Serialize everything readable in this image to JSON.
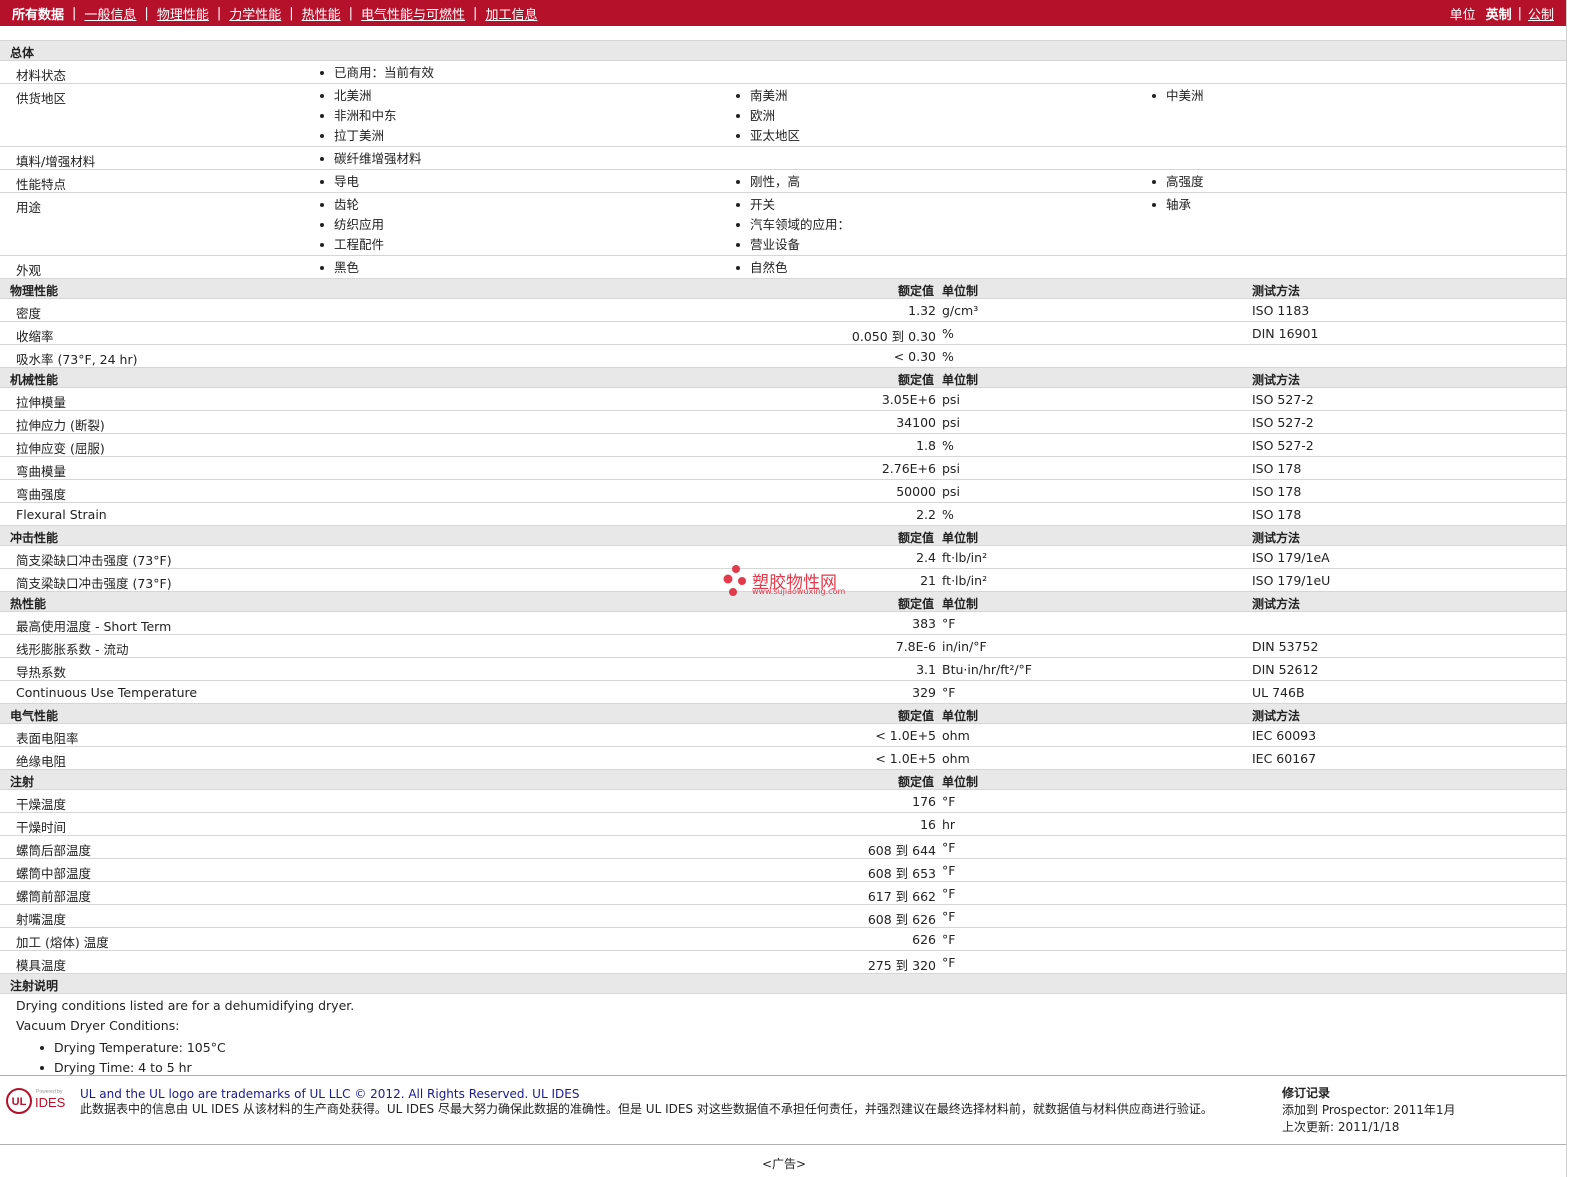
{
  "nav": {
    "items": [
      "所有数据",
      "一般信息",
      "物理性能",
      "力学性能",
      "热性能",
      "电气性能与可燃性",
      "加工信息"
    ]
  },
  "units": {
    "label": "单位",
    "imperial": "英制",
    "metric": "公制"
  },
  "headers": {
    "value": "额定值",
    "unit": "单位制",
    "test": "测试方法"
  },
  "general": {
    "title": "总体",
    "rows": [
      {
        "label": "材料状态",
        "cols": [
          [
            "已商用：当前有效"
          ],
          [],
          []
        ]
      },
      {
        "label": "供货地区",
        "cols": [
          [
            "北美洲",
            "非洲和中东",
            "拉丁美洲"
          ],
          [
            "南美洲",
            "欧洲",
            "亚太地区"
          ],
          [
            "中美洲"
          ]
        ]
      },
      {
        "label": "填料/增强材料",
        "cols": [
          [
            "碳纤维增强材料"
          ],
          [],
          []
        ]
      },
      {
        "label": "性能特点",
        "cols": [
          [
            "导电"
          ],
          [
            "刚性，高"
          ],
          [
            "高强度"
          ]
        ]
      },
      {
        "label": "用途",
        "cols": [
          [
            "齿轮",
            "纺织应用",
            "工程配件"
          ],
          [
            "开关",
            "汽车领域的应用：",
            "营业设备"
          ],
          [
            "轴承"
          ]
        ]
      },
      {
        "label": "外观",
        "cols": [
          [
            "黑色"
          ],
          [
            "自然色"
          ],
          []
        ]
      }
    ]
  },
  "sections": [
    {
      "title": "物理性能",
      "test_header": true,
      "rows": [
        {
          "label": "密度",
          "value": "1.32",
          "unit": "g/cm³",
          "test": "ISO 1183"
        },
        {
          "label": "收缩率",
          "value": "0.050 到  0.30",
          "unit": "%",
          "test": "DIN 16901"
        },
        {
          "label": "吸水率 (73°F, 24 hr)",
          "value": "< 0.30",
          "unit": "%",
          "test": ""
        }
      ]
    },
    {
      "title": "机械性能",
      "test_header": true,
      "rows": [
        {
          "label": "拉伸模量",
          "value": "3.05E+6",
          "unit": "psi",
          "test": "ISO 527-2"
        },
        {
          "label": "拉伸应力 (断裂)",
          "value": "34100",
          "unit": "psi",
          "test": "ISO 527-2"
        },
        {
          "label": "拉伸应变 (屈服)",
          "value": "1.8",
          "unit": "%",
          "test": "ISO 527-2"
        },
        {
          "label": "弯曲模量",
          "value": "2.76E+6",
          "unit": "psi",
          "test": "ISO 178"
        },
        {
          "label": "弯曲强度",
          "value": "50000",
          "unit": "psi",
          "test": "ISO 178"
        },
        {
          "label": "Flexural Strain",
          "value": "2.2",
          "unit": "%",
          "test": "ISO 178"
        }
      ]
    },
    {
      "title": "冲击性能",
      "test_header": true,
      "rows": [
        {
          "label": "简支梁缺口冲击强度 (73°F)",
          "value": "2.4",
          "unit": "ft·lb/in²",
          "test": "ISO 179/1eA"
        },
        {
          "label": "简支梁缺口冲击强度 (73°F)",
          "value": "21",
          "unit": "ft·lb/in²",
          "test": "ISO 179/1eU"
        }
      ]
    },
    {
      "title": "热性能",
      "test_header": true,
      "rows": [
        {
          "label": "最高使用温度 - Short Term",
          "value": "383",
          "unit": "°F",
          "test": ""
        },
        {
          "label": "线形膨胀系数 - 流动",
          "value": "7.8E-6",
          "unit": "in/in/°F",
          "test": "DIN 53752"
        },
        {
          "label": "导热系数",
          "value": "3.1",
          "unit": "Btu·in/hr/ft²/°F",
          "test": "DIN 52612"
        },
        {
          "label": "Continuous Use Temperature",
          "value": "329",
          "unit": "°F",
          "test": "UL 746B"
        }
      ]
    },
    {
      "title": "电气性能",
      "test_header": true,
      "rows": [
        {
          "label": "表面电阻率",
          "value": "< 1.0E+5",
          "unit": "ohm",
          "test": "IEC 60093"
        },
        {
          "label": "绝缘电阻",
          "value": "< 1.0E+5",
          "unit": "ohm",
          "test": "IEC 60167"
        }
      ]
    },
    {
      "title": "注射",
      "test_header": false,
      "rows": [
        {
          "label": "干燥温度",
          "value": "176",
          "unit": "°F",
          "test": ""
        },
        {
          "label": "干燥时间",
          "value": "16",
          "unit": "hr",
          "test": ""
        },
        {
          "label": "螺筒后部温度",
          "value": "608 到  644",
          "unit": "°F",
          "test": ""
        },
        {
          "label": "螺筒中部温度",
          "value": "608 到  653",
          "unit": "°F",
          "test": ""
        },
        {
          "label": "螺筒前部温度",
          "value": "617 到  662",
          "unit": "°F",
          "test": ""
        },
        {
          "label": "射嘴温度",
          "value": "608 到  626",
          "unit": "°F",
          "test": ""
        },
        {
          "label": "加工 (熔体) 温度",
          "value": "626",
          "unit": "°F",
          "test": ""
        },
        {
          "label": "模具温度",
          "value": "275 到  320",
          "unit": "°F",
          "test": ""
        }
      ]
    }
  ],
  "notes": {
    "title": "注射说明",
    "line1": "Drying conditions listed are for a dehumidifying dryer.",
    "line2": "Vacuum Dryer Conditions:",
    "bullets": [
      "Drying Temperature: 105°C",
      "Drying Time: 4 to 5 hr"
    ]
  },
  "footer": {
    "logo_small": "Powered by",
    "logo_text": "IDES",
    "logo_ul": "UL",
    "line1": "UL and the UL logo are trademarks of UL LLC © 2012. All Rights Reserved. UL IDES",
    "line2": "此数据表中的信息由 UL IDES 从该材料的生产商处获得。UL IDES 尽最大努力确保此数据的准确性。但是 UL IDES 对这些数据值不承担任何责任，并强烈建议在最终选择材料前，就数据值与材料供应商进行验证。",
    "rev_title": "修订记录",
    "rev_added": "添加到 Prospector:    2011年1月",
    "rev_updated": "上次更新:    2011/1/18"
  },
  "ad": "<广告>",
  "watermark": {
    "name": "塑胶物性网",
    "url": "www.sujiaowuxing.com"
  },
  "colors": {
    "brand": "#b5112b",
    "section_bg": "#e8e8e8",
    "watermark": "#e23a4a"
  }
}
